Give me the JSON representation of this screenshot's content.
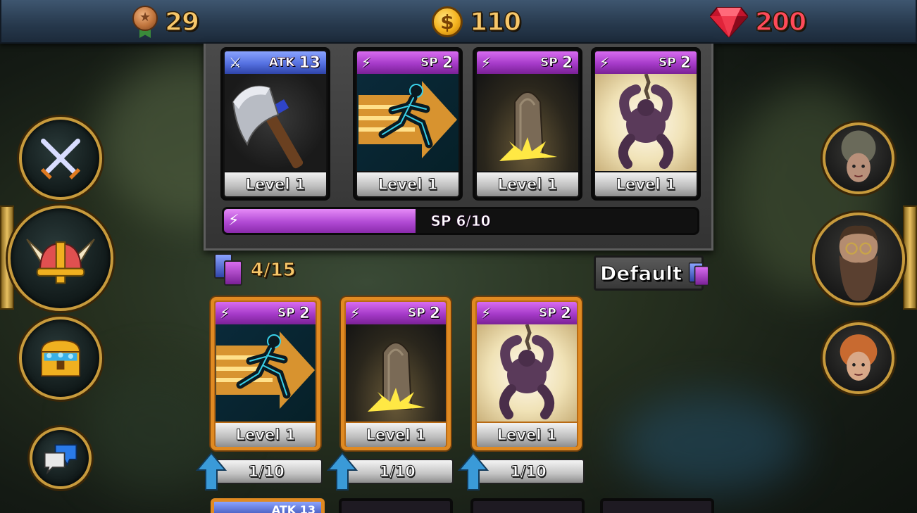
{
  "resources": {
    "medals": "29",
    "coins": "110",
    "coin_symbol": "$",
    "gems": "200"
  },
  "deck": {
    "cards": [
      {
        "type": "ATK",
        "cost_label": "ATK",
        "cost_value": "13",
        "art": "axe",
        "level": "Level 1"
      },
      {
        "type": "SP",
        "cost_label": "SP",
        "cost_value": "2",
        "art": "sprint",
        "level": "Level 1"
      },
      {
        "type": "SP",
        "cost_label": "SP",
        "cost_value": "2",
        "art": "gravestone",
        "level": "Level 1"
      },
      {
        "type": "SP",
        "cost_label": "SP",
        "cost_value": "2",
        "art": "chained-brute",
        "level": "Level 1"
      }
    ],
    "sp_bar_label": "SP 6/10",
    "sp_current": 6,
    "sp_max": 10
  },
  "collection": {
    "count": "4/15",
    "default_button": "Default",
    "cards": [
      {
        "cost_label": "SP",
        "cost_value": "2",
        "art": "sprint",
        "level": "Level 1",
        "progress": "1/10"
      },
      {
        "cost_label": "SP",
        "cost_value": "2",
        "art": "gravestone",
        "level": "Level 1",
        "progress": "1/10"
      },
      {
        "cost_label": "SP",
        "cost_value": "2",
        "art": "chained-brute",
        "level": "Level 1",
        "progress": "1/10"
      }
    ],
    "partial_row_label": "ATK 13"
  },
  "left_nav": [
    "battle-swords-icon",
    "viking-helmet-icon",
    "treasure-chest-icon",
    "chat-icon"
  ],
  "right_nav": [
    "elf-woman-portrait",
    "bearded-dwarf-portrait",
    "redhead-elf-portrait"
  ],
  "colors": {
    "sp_purple": "#b14ad4",
    "atk_blue": "#5470e0",
    "gold_border": "#c79a3c",
    "gem_red": "#e0243a",
    "coin_gold": "#f4b21e",
    "upgrade_arrow": "#3a9ad8"
  }
}
